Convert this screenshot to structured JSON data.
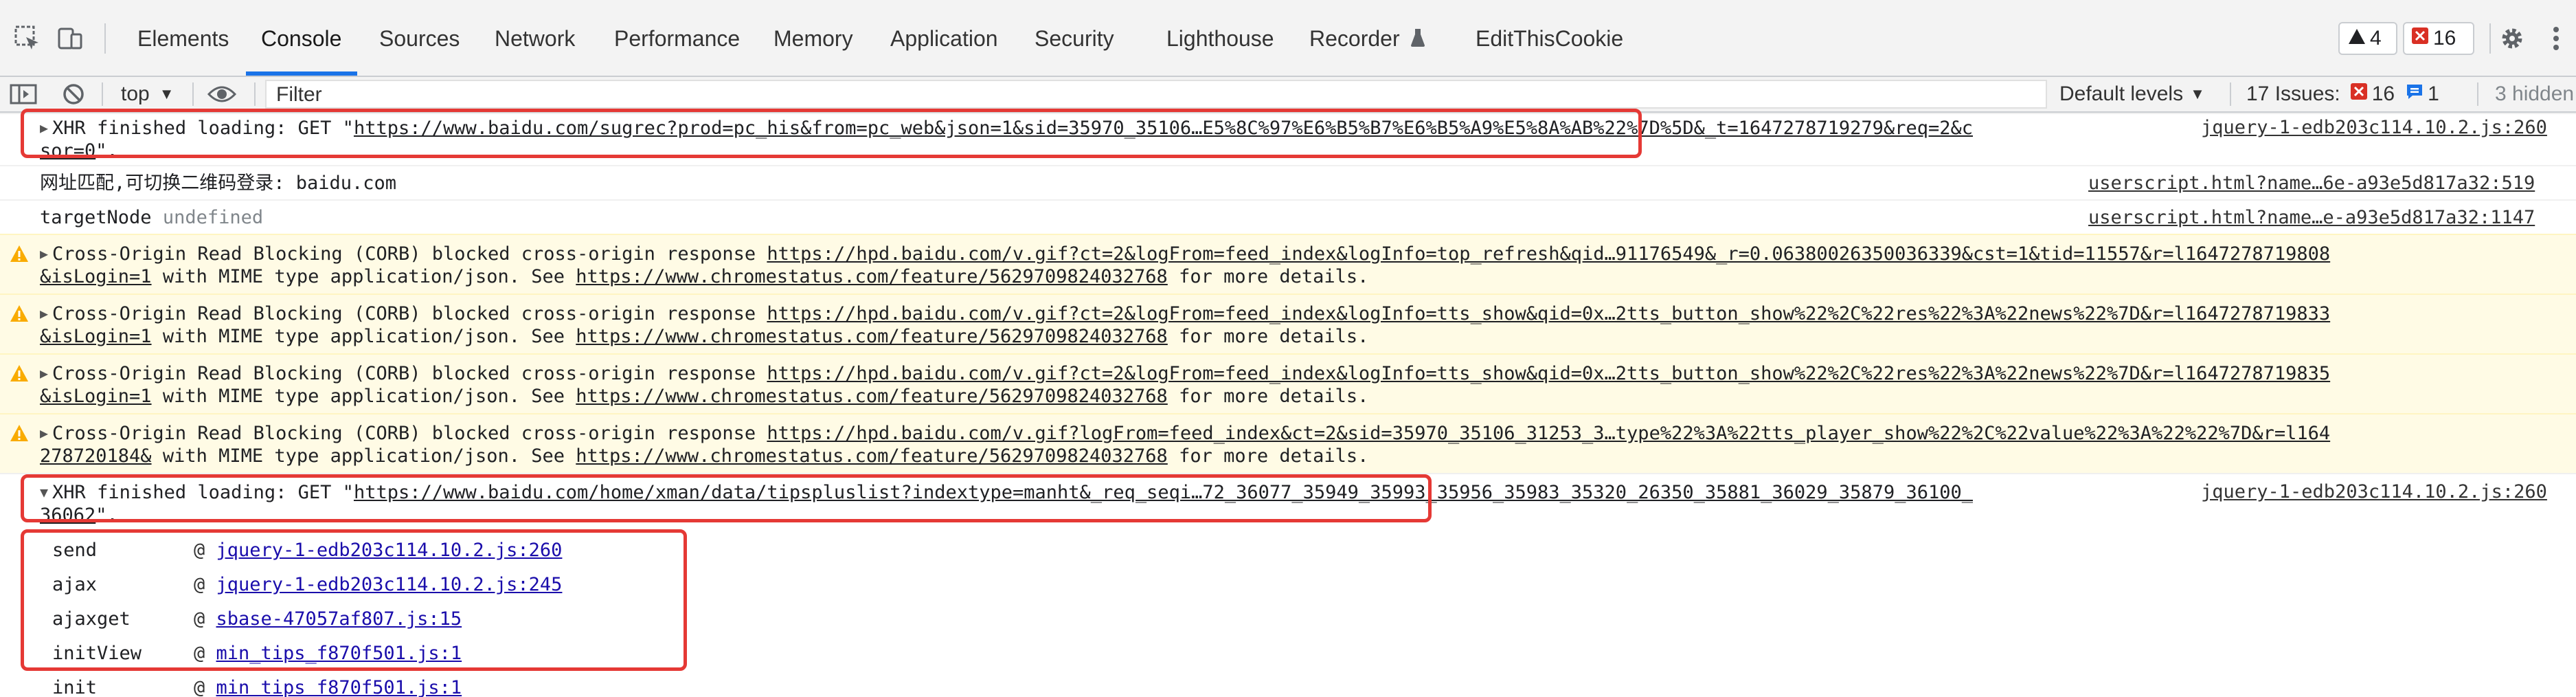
{
  "toolbar": {
    "tabs": [
      {
        "label": "Elements",
        "name": "tab-elements"
      },
      {
        "label": "Console",
        "name": "tab-console"
      },
      {
        "label": "Sources",
        "name": "tab-sources"
      },
      {
        "label": "Network",
        "name": "tab-network"
      },
      {
        "label": "Performance",
        "name": "tab-performance"
      },
      {
        "label": "Memory",
        "name": "tab-memory"
      },
      {
        "label": "Application",
        "name": "tab-application"
      },
      {
        "label": "Security",
        "name": "tab-security"
      },
      {
        "label": "Lighthouse",
        "name": "tab-lighthouse"
      },
      {
        "label": "Recorder",
        "name": "tab-recorder"
      },
      {
        "label": "EditThisCookie",
        "name": "tab-editthiscookie"
      }
    ],
    "active_tab": "Console",
    "warning_count": "4",
    "error_count": "16"
  },
  "filterbar": {
    "context": "top",
    "filter_placeholder": "Filter",
    "levels": "Default levels",
    "issues_label": "17 Issues:",
    "issues_errors": "16",
    "issues_info": "1",
    "hidden": "3 hidden"
  },
  "console": {
    "xhr1": {
      "prefix": "XHR finished loading: GET \"",
      "url": "https://www.baidu.com/sugrec?prod=pc_his&from=pc_web&json=1&sid=35970_35106…E5%8C%97%E6%B5%B7%E6%B5%A9%E5%8A%AB%22%7D%5D&_t=1647278719279&req=2&c",
      "cont": "sor=0",
      "suffix": "\".",
      "source": "jquery-1-edb203c114.10.2.js:260"
    },
    "log1": {
      "text": "网址匹配,可切换二维码登录:  baidu.com",
      "source": "userscript.html?name…6e-a93e5d817a32:519"
    },
    "log2": {
      "label": "targetNode",
      "value": "undefined",
      "source": "userscript.html?name…e-a93e5d817a32:1147"
    },
    "corb": [
      {
        "prefix": "Cross-Origin Read Blocking (CORB) blocked cross-origin response ",
        "url": "https://hpd.baidu.com/v.gif?ct=2&logFrom=feed_index&logInfo=top_refresh&qid…91176549&_r=0.06380026350036339&cst=1&tid=11557&r=l1647278719808",
        "cont": "&isLogin=1"
      },
      {
        "prefix": "Cross-Origin Read Blocking (CORB) blocked cross-origin response ",
        "url": "https://hpd.baidu.com/v.gif?ct=2&logFrom=feed_index&logInfo=tts_show&qid=0x…2tts_button_show%22%2C%22res%22%3A%22news%22%7D&r=l1647278719833",
        "cont": "&isLogin=1"
      },
      {
        "prefix": "Cross-Origin Read Blocking (CORB) blocked cross-origin response ",
        "url": "https://hpd.baidu.com/v.gif?ct=2&logFrom=feed_index&logInfo=tts_show&qid=0x…2tts_button_show%22%2C%22res%22%3A%22news%22%7D&r=l1647278719835",
        "cont": "&isLogin=1"
      },
      {
        "prefix": "Cross-Origin Read Blocking (CORB) blocked cross-origin response ",
        "url": "https://hpd.baidu.com/v.gif?logFrom=feed_index&ct=2&sid=35970_35106_31253_3…type%22%3A%22tts_player_show%22%2C%22value%22%3A%22%22%7D&r=l164",
        "cont": "278720184&"
      }
    ],
    "corb_mid": " with MIME type application/json. See ",
    "corb_link": "https://www.chromestatus.com/feature/5629709824032768",
    "corb_end": " for more details.",
    "xhr2": {
      "prefix": "XHR finished loading: GET \"",
      "url": "https://www.baidu.com/home/xman/data/tipspluslist?indextype=manht&_req_seqi…72_36077_35949_35993_35956_35983_35320_26350_35881_36029_35879_36100_",
      "cont": "36062",
      "suffix": "\".",
      "source": "jquery-1-edb203c114.10.2.js:260"
    },
    "stack": [
      {
        "fn": "send",
        "src": "jquery-1-edb203c114.10.2.js:260"
      },
      {
        "fn": "ajax",
        "src": "jquery-1-edb203c114.10.2.js:245"
      },
      {
        "fn": "ajaxget",
        "src": "sbase-47057af807.js:15"
      },
      {
        "fn": "initView",
        "src": "min_tips_f870f501.js:1"
      },
      {
        "fn": "init",
        "src": "min_tips_f870f501.js:1"
      }
    ]
  }
}
